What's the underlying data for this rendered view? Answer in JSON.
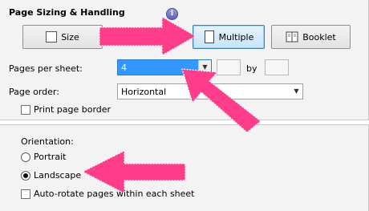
{
  "page_sizing": {
    "title": "Page Sizing & Handling",
    "info_icon": "i",
    "buttons": {
      "size": "Size",
      "multiple": "Multiple",
      "booklet": "Booklet"
    },
    "selected_mode": "Multiple",
    "pages_per_sheet": {
      "label": "Pages per sheet:",
      "value": "4",
      "by_label": "by"
    },
    "page_order": {
      "label": "Page order:",
      "value": "Horizontal"
    },
    "print_border": {
      "label": "Print page border",
      "checked": false
    }
  },
  "orientation": {
    "label": "Orientation:",
    "options": [
      "Portrait",
      "Landscape"
    ],
    "selected": "Landscape",
    "auto_rotate": {
      "label": "Auto-rotate pages within each sheet",
      "checked": false
    }
  },
  "annotation_color": "#ff3d8b",
  "icons": {
    "size": "fit-size-icon",
    "multiple": "multiple-pages-icon",
    "booklet": "booklet-icon",
    "info": "info-icon",
    "dropdown": "chevron-down-icon"
  }
}
